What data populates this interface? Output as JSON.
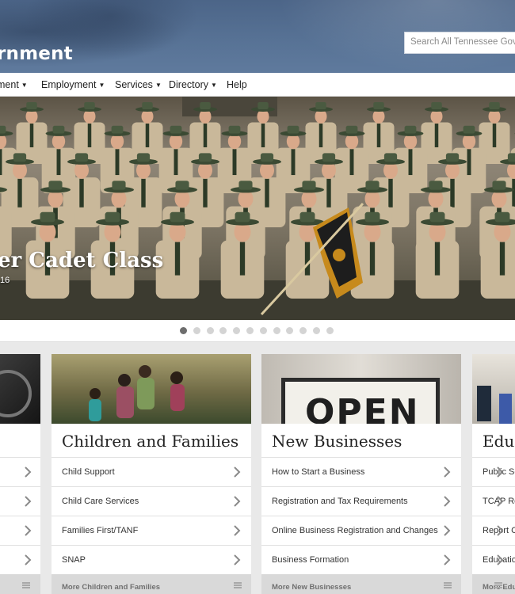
{
  "header": {
    "site_title": "rnment",
    "search_placeholder": "Search All Tennessee Government"
  },
  "nav": {
    "items": [
      {
        "label": "ment",
        "has_caret": true
      },
      {
        "label": "Employment",
        "has_caret": true
      },
      {
        "label": "Services",
        "has_caret": true
      },
      {
        "label": "Directory",
        "has_caret": true
      },
      {
        "label": "Help",
        "has_caret": false
      }
    ],
    "caret_glyph": "▼"
  },
  "hero": {
    "caption": "er Cadet Class",
    "date": "16",
    "slide_count": 12,
    "active_slide": 1
  },
  "cards": [
    {
      "title": "",
      "links": [
        "",
        "",
        "",
        ""
      ],
      "more": ""
    },
    {
      "title": "Children and Families",
      "links": [
        "Child Support",
        "Child Care Services",
        "Families First/TANF",
        "SNAP"
      ],
      "more": "More Children and Families"
    },
    {
      "title": "New Businesses",
      "links": [
        "How to Start a Business",
        "Registration and Tax Requirements",
        "Online Business Registration and Changes",
        "Business Formation"
      ],
      "more": "More New Businesses",
      "sign_text": "OPEN"
    },
    {
      "title": "Educ",
      "links": [
        "Public Sch",
        "TCAP Resu",
        "Report Ca",
        "Education"
      ],
      "more": "More Educ"
    }
  ],
  "icons": {
    "chevron": "chevron-right-icon",
    "menu": "menu-lines-icon",
    "caret": "caret-down-icon"
  },
  "colors": {
    "header": "#587396",
    "hat": "#3b4a33",
    "uniform": "#c9b89a",
    "flag": "#c78a1c"
  }
}
